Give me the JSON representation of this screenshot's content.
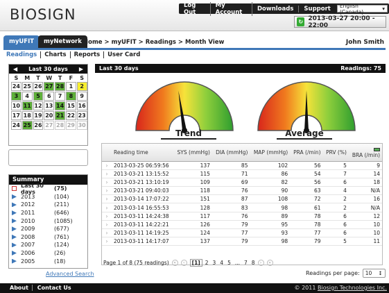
{
  "header": {
    "logo": "BIOSIGN",
    "nav": {
      "logout": "Log Out",
      "account": "My Account",
      "downloads": "Downloads",
      "support": "Support"
    },
    "language": "English (Canada)",
    "datetime": "2013-03-27 20:00 - 22:00"
  },
  "tabs": {
    "myufit": "myUFIT",
    "mynetwork": "myNetwork"
  },
  "breadcrumb": "Home > myUFIT > Readings > Month View",
  "user": "John Smith",
  "subnav": [
    "Readings",
    "Charts",
    "Reports",
    "User Card"
  ],
  "calendar": {
    "title": "Last 30 days",
    "dow": [
      "S",
      "M",
      "T",
      "W",
      "T",
      "F",
      "S"
    ],
    "weeks": [
      [
        {
          "d": "24",
          "s": ""
        },
        {
          "d": "25",
          "s": ""
        },
        {
          "d": "26",
          "s": ""
        },
        {
          "d": "27",
          "s": "g"
        },
        {
          "d": "28",
          "s": "g"
        },
        {
          "d": "1",
          "s": ""
        },
        {
          "d": "2",
          "s": "y"
        }
      ],
      [
        {
          "d": "3",
          "s": "g"
        },
        {
          "d": "4",
          "s": ""
        },
        {
          "d": "5",
          "s": "g"
        },
        {
          "d": "6",
          "s": ""
        },
        {
          "d": "7",
          "s": ""
        },
        {
          "d": "8",
          "s": "g"
        },
        {
          "d": "9",
          "s": ""
        }
      ],
      [
        {
          "d": "10",
          "s": ""
        },
        {
          "d": "11",
          "s": "g"
        },
        {
          "d": "12",
          "s": ""
        },
        {
          "d": "13",
          "s": ""
        },
        {
          "d": "14",
          "s": "g"
        },
        {
          "d": "15",
          "s": ""
        },
        {
          "d": "16",
          "s": ""
        }
      ],
      [
        {
          "d": "17",
          "s": ""
        },
        {
          "d": "18",
          "s": ""
        },
        {
          "d": "19",
          "s": ""
        },
        {
          "d": "20",
          "s": ""
        },
        {
          "d": "21",
          "s": "g"
        },
        {
          "d": "22",
          "s": ""
        },
        {
          "d": "23",
          "s": ""
        }
      ],
      [
        {
          "d": "24",
          "s": ""
        },
        {
          "d": "25",
          "s": "g"
        },
        {
          "d": "26",
          "s": ""
        },
        {
          "d": "27",
          "s": "d"
        },
        {
          "d": "28",
          "s": "d"
        },
        {
          "d": "29",
          "s": "d"
        },
        {
          "d": "30",
          "s": "d"
        }
      ]
    ]
  },
  "summary": {
    "title": "Summary",
    "rows": [
      {
        "label": "Last 30 days",
        "count": "(75)"
      },
      {
        "label": "2013",
        "count": "(104)"
      },
      {
        "label": "2012",
        "count": "(211)"
      },
      {
        "label": "2011",
        "count": "(646)"
      },
      {
        "label": "2010",
        "count": "(1085)"
      },
      {
        "label": "2009",
        "count": "(677)"
      },
      {
        "label": "2008",
        "count": "(761)"
      },
      {
        "label": "2007",
        "count": "(124)"
      },
      {
        "label": "2006",
        "count": "(26)"
      },
      {
        "label": "2005",
        "count": "(18)"
      }
    ],
    "advanced_search": "Advanced Search"
  },
  "main": {
    "bar_title": "Last 30 days",
    "readings_count": "Readings: 75",
    "gauge_trend": "Trend",
    "gauge_average": "Average",
    "trend_level": 0.02,
    "average_level": 0.5
  },
  "table": {
    "headers": [
      "Reading time",
      "SYS (mmHg)",
      "DIA (mmHg)",
      "MAP (mmHg)",
      "PRA (/min)",
      "PRV (%)",
      "BRA (/min)"
    ],
    "rows": [
      [
        "2013-03-25 06:59:56",
        "137",
        "85",
        "102",
        "56",
        "5",
        "9"
      ],
      [
        "2013-03-21 13:15:52",
        "115",
        "71",
        "86",
        "54",
        "7",
        "14"
      ],
      [
        "2013-03-21 13:10:19",
        "109",
        "69",
        "82",
        "56",
        "6",
        "18"
      ],
      [
        "2013-03-21 09:40:03",
        "118",
        "76",
        "90",
        "63",
        "4",
        "N/A"
      ],
      [
        "2013-03-14 17:07:22",
        "151",
        "87",
        "108",
        "72",
        "2",
        "16"
      ],
      [
        "2013-03-14 16:55:53",
        "128",
        "83",
        "98",
        "61",
        "2",
        "N/A"
      ],
      [
        "2013-03-11 14:24:38",
        "117",
        "76",
        "89",
        "78",
        "6",
        "12"
      ],
      [
        "2013-03-11 14:22:21",
        "126",
        "79",
        "95",
        "78",
        "6",
        "10"
      ],
      [
        "2013-03-11 14:19:25",
        "124",
        "77",
        "93",
        "77",
        "6",
        "10"
      ],
      [
        "2013-03-11 14:17:07",
        "137",
        "79",
        "98",
        "79",
        "5",
        "11"
      ]
    ]
  },
  "pager": {
    "info": "Page 1 of 8 (75 readings)",
    "current": "[1]",
    "pages": [
      "2",
      "3",
      "4",
      "5",
      "...",
      "7",
      "8"
    ]
  },
  "per_page": {
    "label": "Readings per page:",
    "value": "10"
  },
  "footer": {
    "about": "About",
    "contact": "Contact Us",
    "copyright": "© 2011",
    "company": "Biosign Technologies Inc."
  },
  "colors": {
    "accent": "#3f78b8",
    "green": "#5fb03a",
    "yellow": "#f6ee2e"
  }
}
